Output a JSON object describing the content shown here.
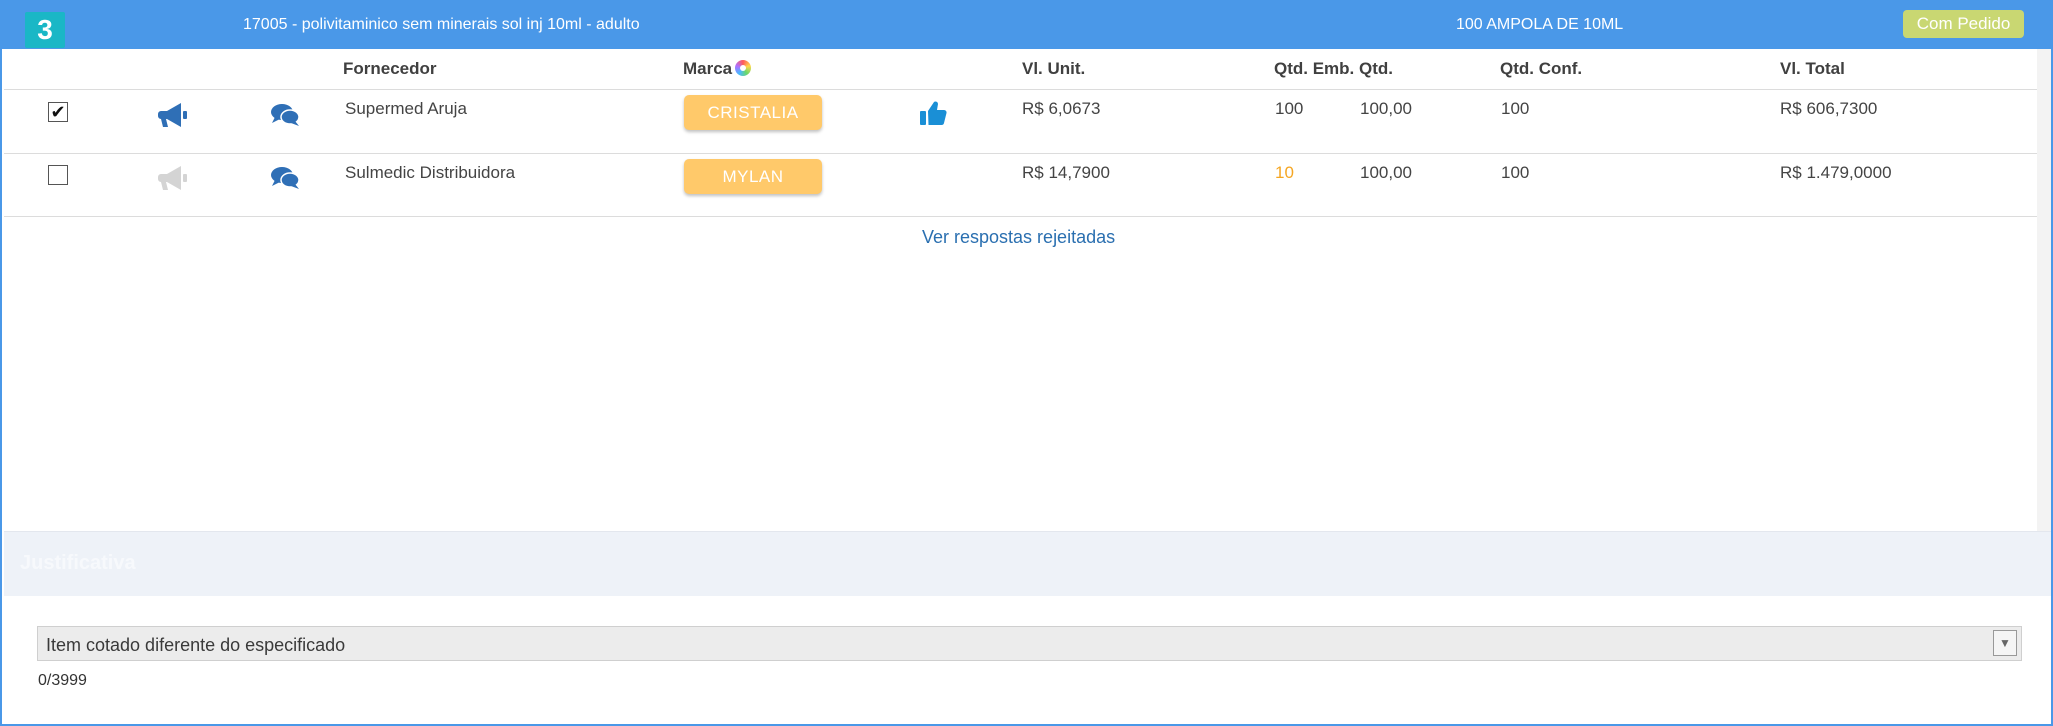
{
  "item": {
    "number": "3",
    "description": "17005 - polivitaminico sem minerais sol inj 10ml - adulto",
    "unit": "100 AMPOLA DE 10ML",
    "status": "Com Pedido"
  },
  "columns": {
    "supplier": "Fornecedor",
    "brand": "Marca",
    "unit_price": "Vl. Unit.",
    "pack_qty": "Qtd. Emb.",
    "qty": "Qtd.",
    "qty_conf": "Qtd. Conf.",
    "total": "Vl. Total"
  },
  "rows": [
    {
      "checked": true,
      "megaphone": "active",
      "supplier": "Supermed Aruja",
      "brand": "CRISTALIA",
      "liked": true,
      "unit_price": "R$ 6,0673",
      "pack_qty": "100",
      "qty": "100,00",
      "qty_conf": "100",
      "total": "R$ 606,7300"
    },
    {
      "checked": false,
      "megaphone": "inactive",
      "supplier": "Sulmedic Distribuidora",
      "brand": "MYLAN",
      "liked": false,
      "unit_price": "R$ 14,7900",
      "pack_qty": "10",
      "pack_qty_color": "#f5a623",
      "qty": "100,00",
      "qty_conf": "100",
      "total": "R$ 1.479,0000"
    }
  ],
  "rejected_link": "Ver respostas rejeitadas",
  "justification": {
    "title": "Justificativa",
    "selected": "Item cotado diferente do especificado",
    "counter": "0/3999"
  },
  "colors": {
    "header": "#4a98e8",
    "badge": "#1ab7c6",
    "status": "#c9d772",
    "brand_button": "#ffc96a",
    "icon_blue": "#2f6fb6",
    "like_blue": "#1a8fd6"
  }
}
